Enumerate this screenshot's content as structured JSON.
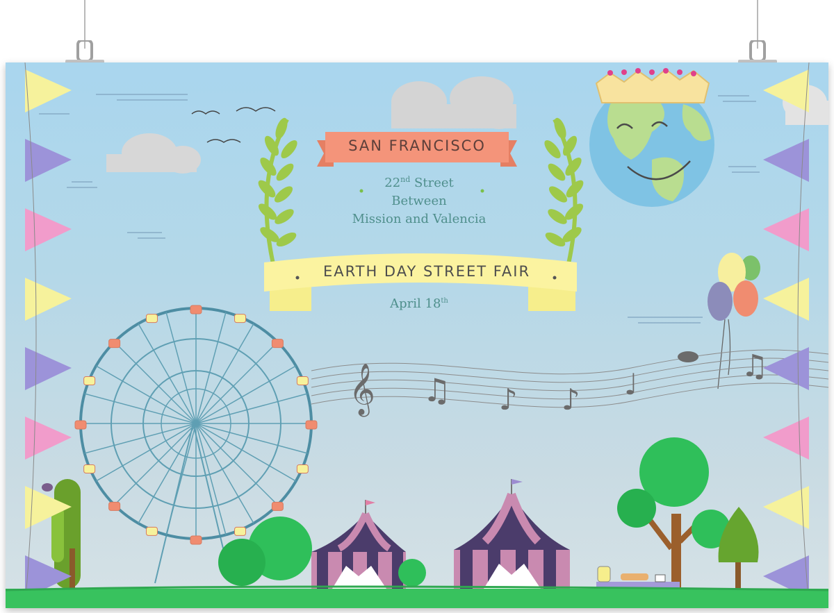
{
  "banner": {
    "city": "SAN FRANCISCO"
  },
  "address": {
    "line1_number": "22",
    "line1_suffix": "nd",
    "line1_rest": " Street",
    "line2": "Between",
    "line3": "Mission and Valencia"
  },
  "event": {
    "title": "EARTH DAY STREET FAIR",
    "date_main": "April 18",
    "date_suffix": "th"
  },
  "colors": {
    "sky": "#a9d6ee",
    "ground": "#38c25e",
    "ribbon_orange": "#f4947a",
    "ribbon_yellow": "#fbf3a0",
    "text_teal": "#4f8f8c",
    "ferris_wheel": "#5f9fb3",
    "flag_yellow": "#f6f29c",
    "flag_purple": "#9c93d9",
    "flag_pink": "#f19ccb"
  },
  "icons": [
    "laurel-icon",
    "earth-icon",
    "crown-icon",
    "ferris-wheel-icon",
    "music-note-icon",
    "treble-clef-icon",
    "balloon-icon",
    "tent-icon",
    "tree-icon",
    "bird-icon",
    "cloud-icon",
    "bunting-flag-icon"
  ]
}
